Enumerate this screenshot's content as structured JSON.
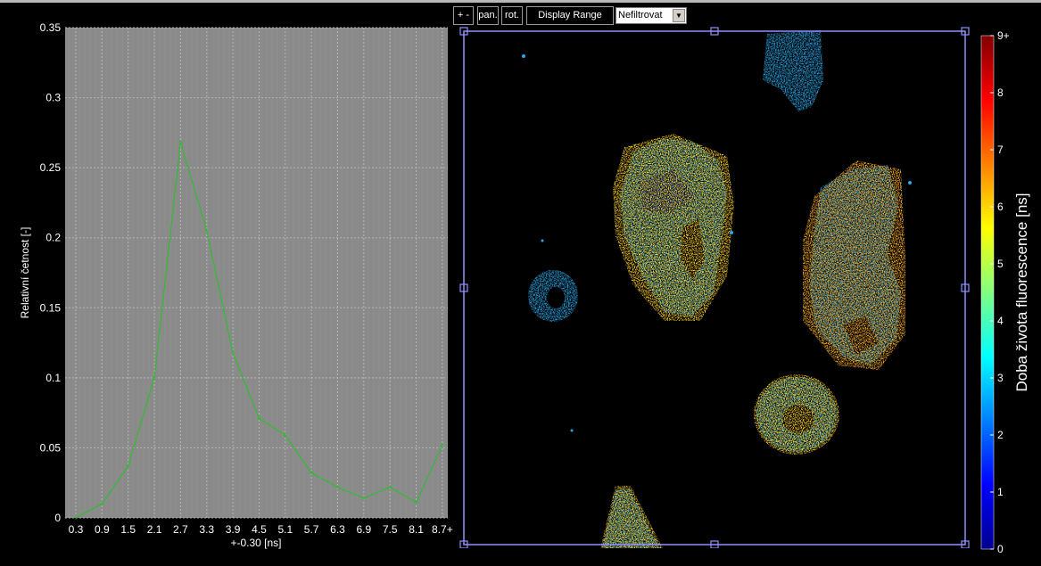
{
  "toolbar": {
    "zoom_label": "+ -",
    "pan_label": "pan.",
    "rot_label": "rot.",
    "display_range_label": "Display Range",
    "filter_selected": "Nefiltrovat"
  },
  "chart_data": [
    {
      "type": "line",
      "ylabel": "Relativní četnost [-]",
      "xlabel": "+-0.30 [ns]",
      "categories": [
        "0.3",
        "0.9",
        "1.5",
        "2.1",
        "2.7",
        "3.3",
        "3.9",
        "4.5",
        "5.1",
        "5.7",
        "6.3",
        "6.9",
        "7.5",
        "8.1",
        "8.7+"
      ],
      "values": [
        0.0,
        0.01,
        0.037,
        0.1,
        0.268,
        0.205,
        0.118,
        0.071,
        0.059,
        0.032,
        0.022,
        0.014,
        0.022,
        0.011,
        0.052
      ],
      "ylim": [
        0,
        0.35
      ],
      "yticks": [
        "0",
        "0.05",
        "0.1",
        "0.15",
        "0.2",
        "0.25",
        "0.3",
        "0.35"
      ],
      "grid": true,
      "colors": {
        "line": "#22c322",
        "background": "#8a8a8a",
        "grid": "#b4b4b4"
      }
    },
    {
      "type": "heatmap",
      "colorbar_label": "Doba života fluorescence [ns]",
      "colorbar_ticks": [
        "0",
        "1",
        "2",
        "3",
        "4",
        "5",
        "6",
        "7",
        "8",
        "9+"
      ],
      "colormap": [
        "#00008f",
        "#0000ff",
        "#0080ff",
        "#00ffff",
        "#80ff80",
        "#ffff00",
        "#ff8000",
        "#ff0000",
        "#800000"
      ]
    }
  ]
}
